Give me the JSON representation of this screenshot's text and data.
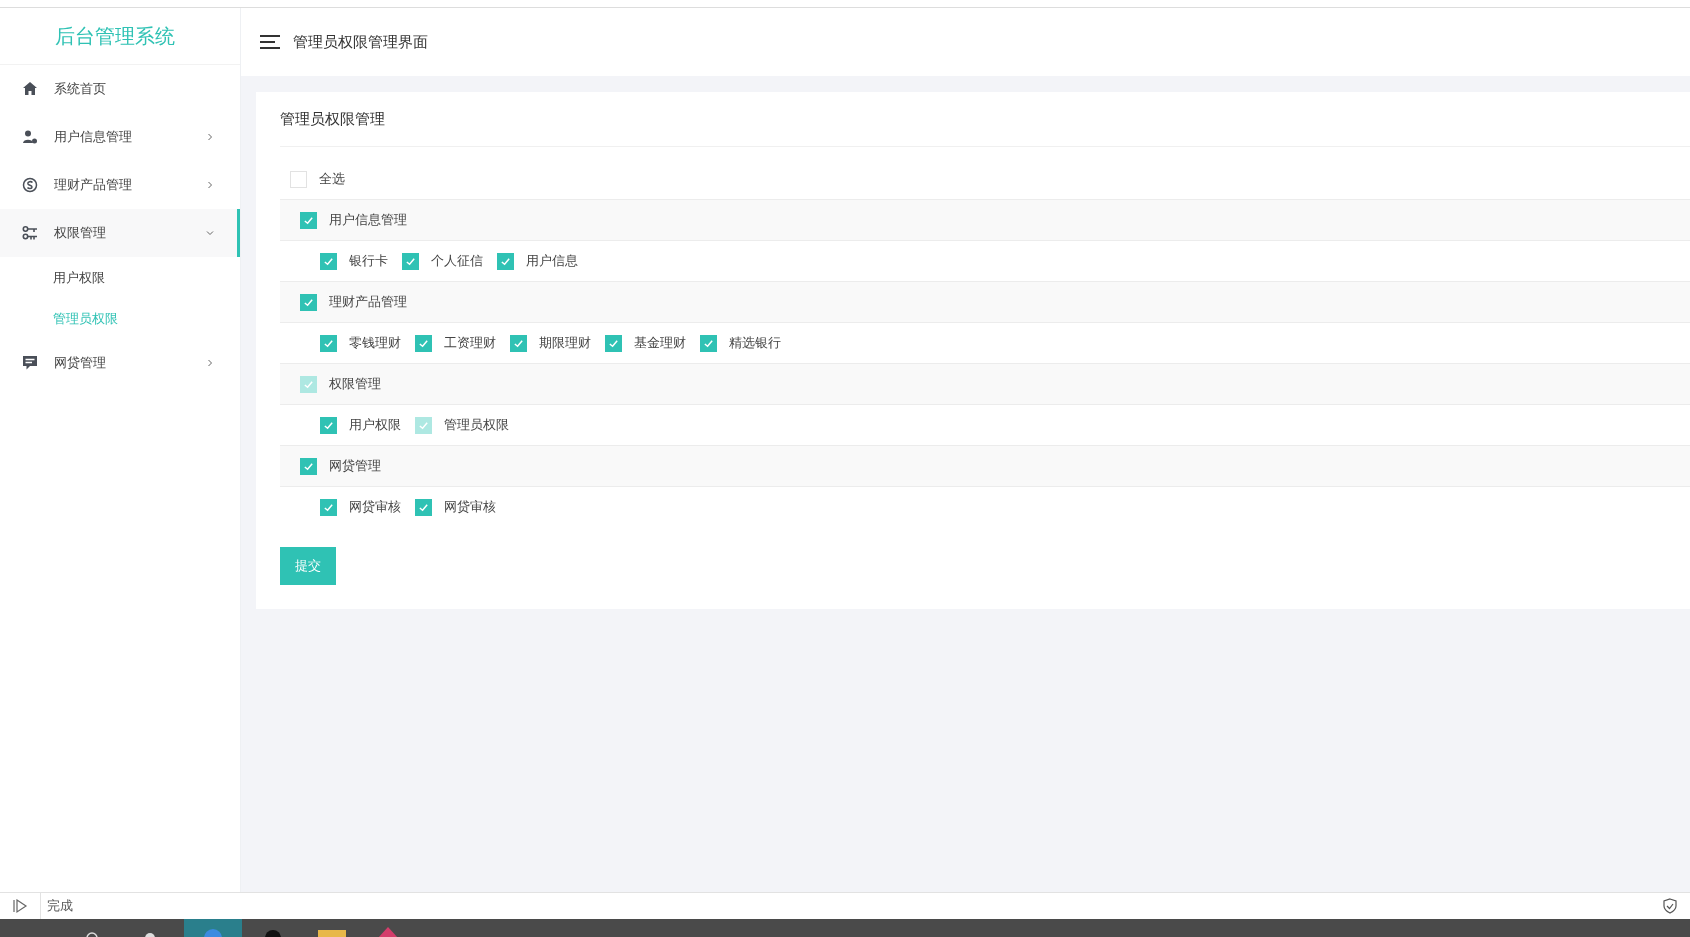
{
  "sidebar": {
    "title": "后台管理系统",
    "items": [
      {
        "label": "系统首页"
      },
      {
        "label": "用户信息管理",
        "expanded": false
      },
      {
        "label": "理财产品管理",
        "expanded": false
      },
      {
        "label": "权限管理",
        "expanded": true,
        "children": [
          {
            "label": "用户权限",
            "selected": false
          },
          {
            "label": "管理员权限",
            "selected": true
          }
        ]
      },
      {
        "label": "网贷管理",
        "expanded": false
      }
    ]
  },
  "header": {
    "title": "管理员权限管理界面"
  },
  "card": {
    "title": "管理员权限管理",
    "select_all": {
      "label": "全选",
      "checked": false
    },
    "groups": [
      {
        "label": "用户信息管理",
        "checked": true,
        "disabled": false,
        "children": [
          {
            "label": "银行卡",
            "checked": true,
            "disabled": false
          },
          {
            "label": "个人征信",
            "checked": true,
            "disabled": false
          },
          {
            "label": "用户信息",
            "checked": true,
            "disabled": false
          }
        ]
      },
      {
        "label": "理财产品管理",
        "checked": true,
        "disabled": false,
        "children": [
          {
            "label": "零钱理财",
            "checked": true,
            "disabled": false
          },
          {
            "label": "工资理财",
            "checked": true,
            "disabled": false
          },
          {
            "label": "期限理财",
            "checked": true,
            "disabled": false
          },
          {
            "label": "基金理财",
            "checked": true,
            "disabled": false
          },
          {
            "label": "精选银行",
            "checked": true,
            "disabled": false
          }
        ]
      },
      {
        "label": "权限管理",
        "checked": true,
        "disabled": true,
        "children": [
          {
            "label": "用户权限",
            "checked": true,
            "disabled": false
          },
          {
            "label": "管理员权限",
            "checked": true,
            "disabled": true
          }
        ]
      },
      {
        "label": "网贷管理",
        "checked": true,
        "disabled": false,
        "children": [
          {
            "label": "网贷审核",
            "checked": true,
            "disabled": false
          },
          {
            "label": "网贷审核",
            "checked": true,
            "disabled": false
          }
        ]
      }
    ],
    "submit": "提交"
  },
  "status_bar": {
    "text": "完成"
  }
}
